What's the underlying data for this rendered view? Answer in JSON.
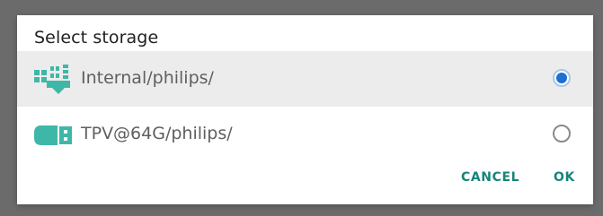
{
  "dialog": {
    "title": "Select storage"
  },
  "options": [
    {
      "label": "Internal/philips/",
      "icon": "internal-storage-icon",
      "selected": true
    },
    {
      "label": "TPV@64G/philips/",
      "icon": "usb-drive-icon",
      "selected": false
    }
  ],
  "actions": {
    "cancel_label": "CANCEL",
    "ok_label": "OK"
  },
  "colors": {
    "accent": "#168579",
    "radio_selected": "#1e6fd2",
    "icon": "#3fb7a8",
    "backdrop": "#6b6b6b"
  }
}
